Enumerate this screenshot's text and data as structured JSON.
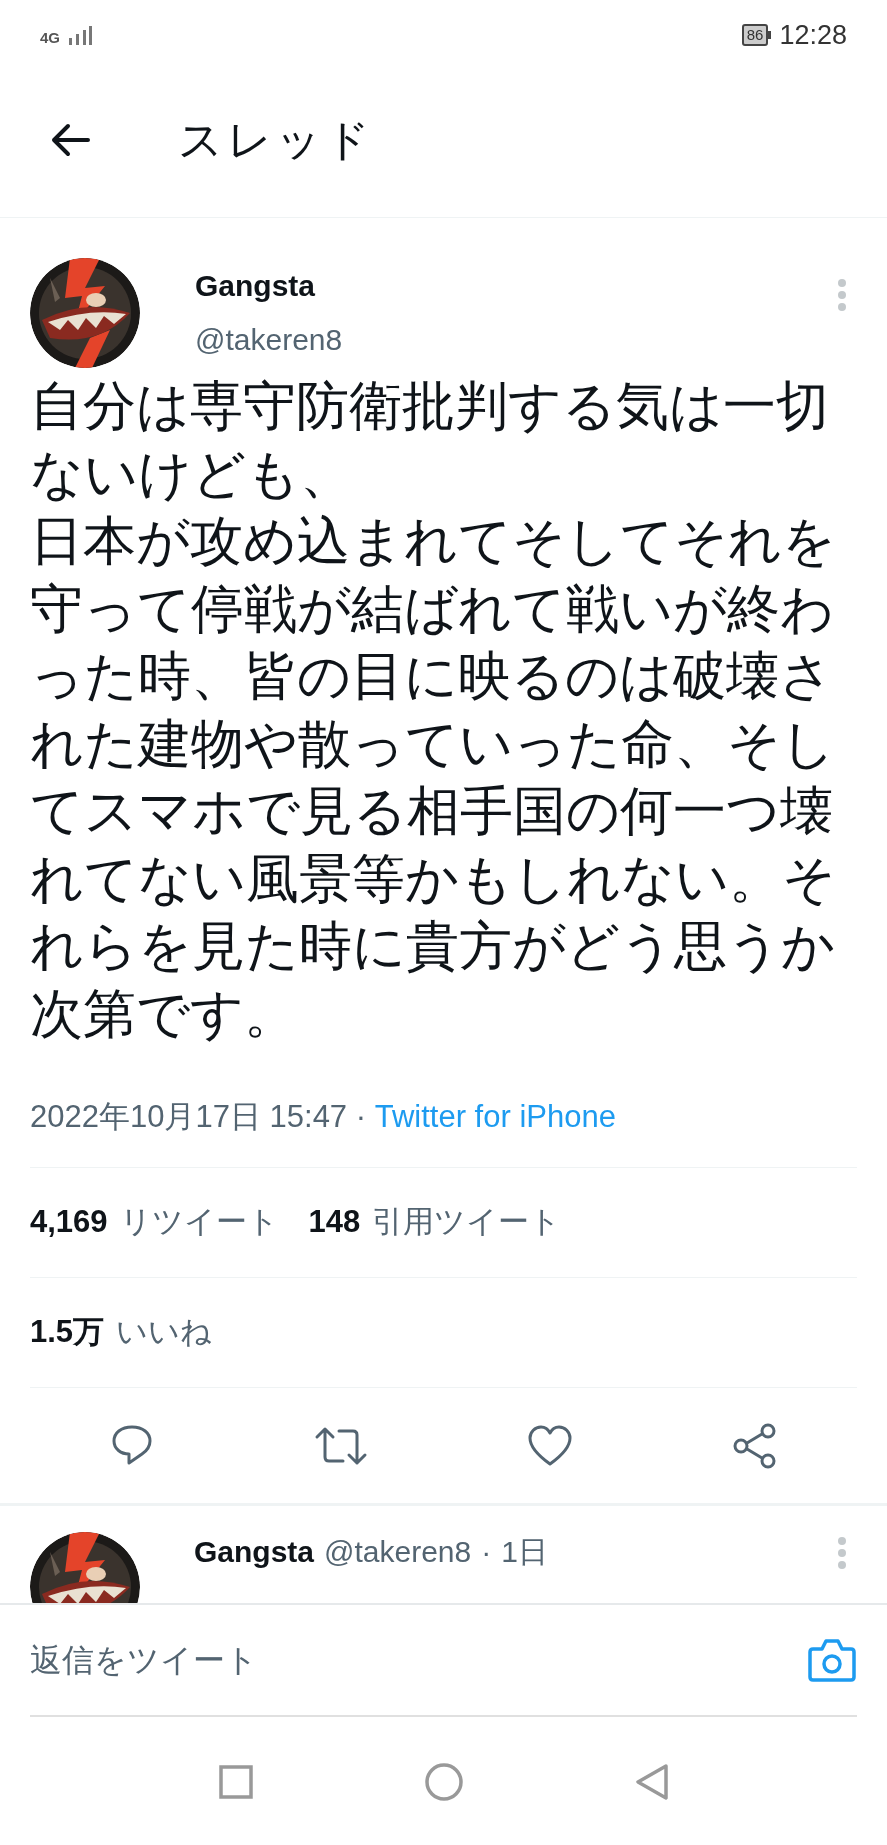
{
  "status_bar": {
    "network": "4G",
    "battery": "86",
    "time": "12:28"
  },
  "header": {
    "title": "スレッド"
  },
  "tweet": {
    "name": "Gangsta",
    "handle": "@takeren8",
    "paragraphs": [
      "自分は専守防衛批判する気は一切ないけども、",
      "日本が攻め込まれてそしてそれを守って停戦が結ばれて戦いが終わった時、皆の目に映るのは破壊された建物や散っていった命、そしてスマホで見る相手国の何一つ壊れてない風景等かもしれない。それらを見た時に貴方がどう思うか次第です。"
    ],
    "timestamp": "2022年10月17日 15:47",
    "separator": "·",
    "source": "Twitter for iPhone",
    "stats": [
      {
        "count": "4,169",
        "label": "リツイート"
      },
      {
        "count": "148",
        "label": "引用ツイート"
      }
    ],
    "likes": {
      "count": "1.5万",
      "label": "いいね"
    }
  },
  "reply_preview": {
    "name": "Gangsta",
    "handle": "@takeren8",
    "separator": "·",
    "age": "1日"
  },
  "composer": {
    "placeholder": "返信をツイート"
  }
}
